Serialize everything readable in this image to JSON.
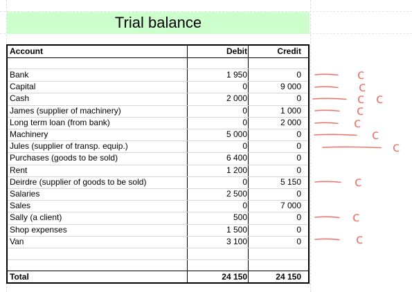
{
  "title": "Trial balance",
  "headers": {
    "account": "Account",
    "debit": "Debit",
    "credit": "Credit"
  },
  "rows": [
    {
      "account": "Bank",
      "debit": "1 950",
      "credit": "0"
    },
    {
      "account": "Capital",
      "debit": "0",
      "credit": "9 000"
    },
    {
      "account": "Cash",
      "debit": "2 000",
      "credit": "0"
    },
    {
      "account": "James (supplier of machinery)",
      "debit": "0",
      "credit": "1 000"
    },
    {
      "account": "Long term loan (from bank)",
      "debit": "0",
      "credit": "2 000"
    },
    {
      "account": "Machinery",
      "debit": "5 000",
      "credit": "0"
    },
    {
      "account": "Jules (supplier of transp. equip.)",
      "debit": "0",
      "credit": "0"
    },
    {
      "account": "Purchases (goods to be sold)",
      "debit": "6 400",
      "credit": "0"
    },
    {
      "account": "Rent",
      "debit": "1 200",
      "credit": "0"
    },
    {
      "account": "Deirdre (supplier of goods to be sold)",
      "debit": "0",
      "credit": "5 150"
    },
    {
      "account": "Salaries",
      "debit": "2 500",
      "credit": "0"
    },
    {
      "account": "Sales",
      "debit": "0",
      "credit": "7 000"
    },
    {
      "account": "Sally (a client)",
      "debit": "500",
      "credit": "0"
    },
    {
      "account": "Shop expenses",
      "debit": "1 500",
      "credit": "0"
    },
    {
      "account": "Van",
      "debit": "3 100",
      "credit": "0"
    }
  ],
  "total": {
    "label": "Total",
    "debit": "24 150",
    "credit": "24 150"
  },
  "annotation_mark": "c",
  "colors": {
    "title_bg": "#ccffcc",
    "annotation": "#e8786e"
  }
}
